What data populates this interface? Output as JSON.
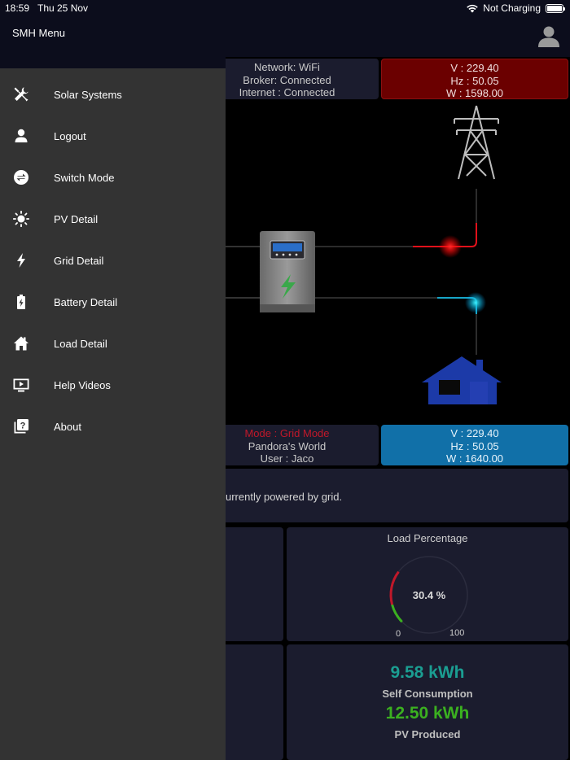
{
  "status_bar": {
    "time": "18:59",
    "date": "Thu 25 Nov",
    "charging": "Not Charging"
  },
  "menu": {
    "title": "SMH Menu",
    "items": [
      {
        "label": "Solar Systems",
        "icon": "tools-icon"
      },
      {
        "label": "Logout",
        "icon": "person-icon"
      },
      {
        "label": "Switch Mode",
        "icon": "switch-icon"
      },
      {
        "label": "PV Detail",
        "icon": "sun-icon"
      },
      {
        "label": "Grid Detail",
        "icon": "bolt-icon"
      },
      {
        "label": "Battery Detail",
        "icon": "battery-icon"
      },
      {
        "label": "Load Detail",
        "icon": "home-icon"
      },
      {
        "label": "Help Videos",
        "icon": "video-icon"
      },
      {
        "label": "About",
        "icon": "help-icon"
      }
    ]
  },
  "network": {
    "network": "Network: WiFi",
    "broker": "Broker: Connected",
    "internet": "Internet : Connected"
  },
  "grid": {
    "v": "V : 229.40",
    "hz": "Hz : 50.05",
    "w": "W : 1598.00"
  },
  "system": {
    "mode": "Mode : Grid Mode",
    "site": "Pandora's World",
    "user": "User : Jaco"
  },
  "load": {
    "v": "V : 229.40",
    "hz": "Hz : 50.05",
    "w": "W : 1640.00"
  },
  "status_message": "urrently powered by grid.",
  "gauge": {
    "title": "Load Percentage",
    "value": 30.4,
    "display": "30.4 %",
    "min": "0",
    "max": "100"
  },
  "energy": {
    "self_consumption_value": "9.58 kWh",
    "self_consumption_label": "Self Consumption",
    "pv_produced_value": "12.50 kWh",
    "pv_produced_label": "PV Produced"
  },
  "colors": {
    "grid_panel": "#6b0000",
    "load_panel": "#1170a8",
    "mode_text": "#c0182a",
    "self_consumption": "#1b9e92",
    "pv_produced": "#3bb020",
    "grid_line": "#e0101a",
    "load_line": "#17a6c8"
  }
}
